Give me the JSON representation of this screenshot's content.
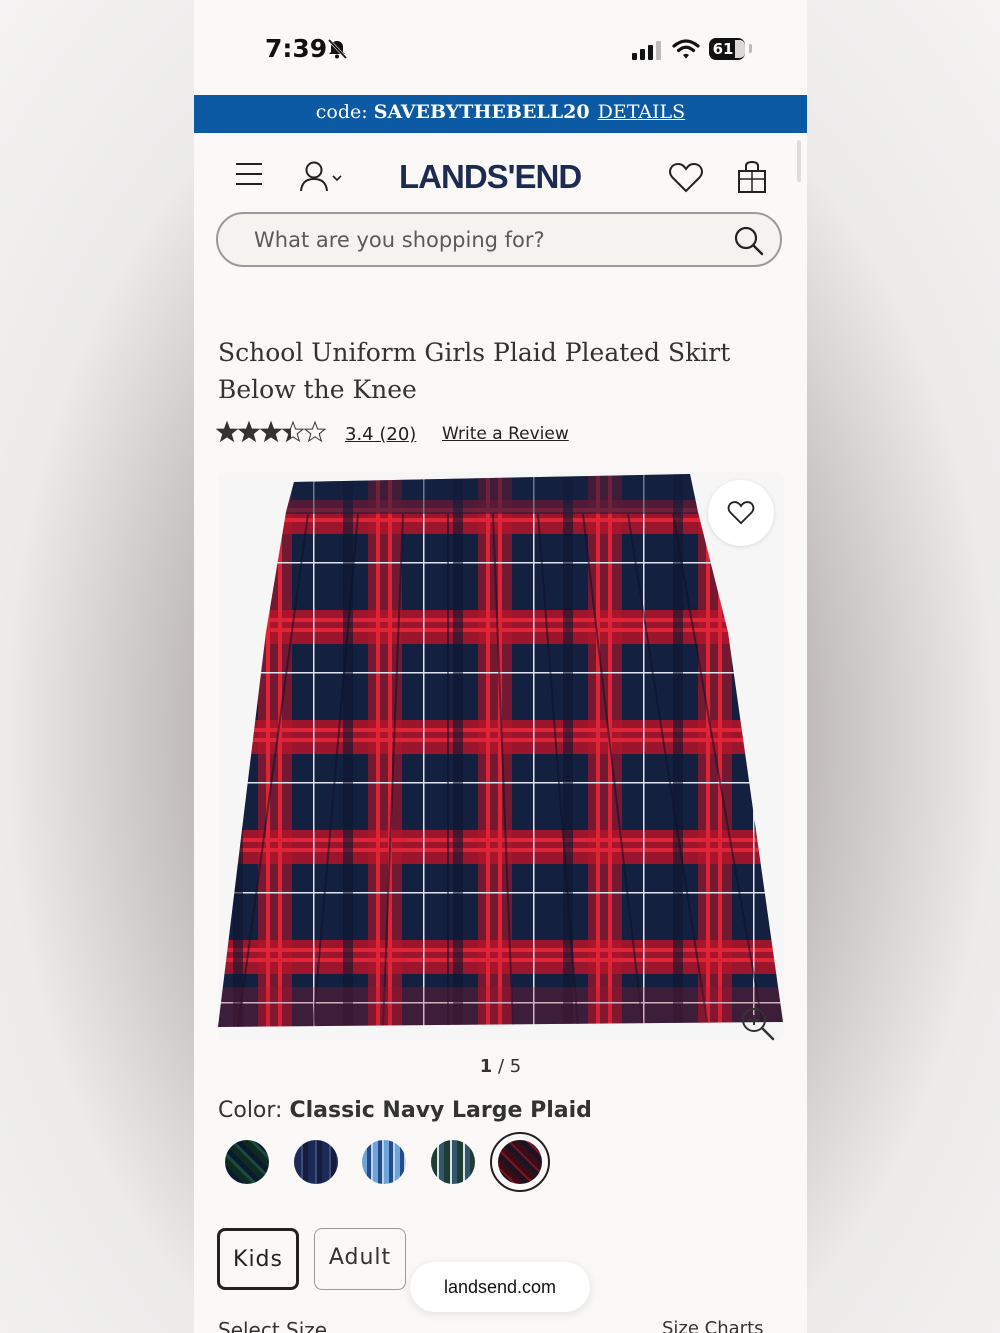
{
  "status_bar": {
    "time": "7:39",
    "battery": "61"
  },
  "promo": {
    "prefix": "code: ",
    "code": "SAVEBYTHEBELL20",
    "details": "DETAILS",
    "color": "#0b5aa3"
  },
  "header": {
    "logo": "LANDS'END",
    "icons": [
      "menu-icon",
      "account-icon",
      "heart-icon",
      "shopping-bag-icon"
    ]
  },
  "search": {
    "placeholder": "What are you shopping for?"
  },
  "product": {
    "title": "School Uniform Girls Plaid Pleated Skirt Below the Knee",
    "rating": "3.4",
    "review_count": "(20)",
    "write_review": "Write a Review",
    "stars_value": 3.4,
    "image_pager_current": "1",
    "image_pager_total": "/ 5"
  },
  "color": {
    "label": "Color: ",
    "selected": "Classic Navy Large Plaid",
    "swatches": [
      "green-navy plaid",
      "navy plaid",
      "blue plaid",
      "green-white plaid",
      "classic navy large plaid"
    ]
  },
  "fit_tabs": [
    "Kids",
    "Adult"
  ],
  "browser": {
    "url": "landsend.com"
  },
  "size": {
    "label": "Select Size",
    "charts": "Size Charts"
  }
}
